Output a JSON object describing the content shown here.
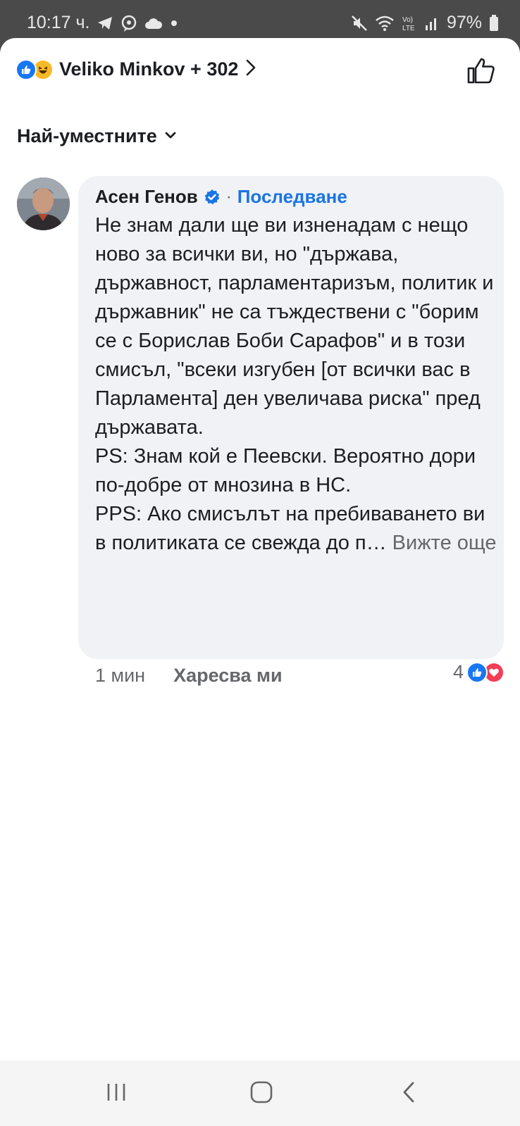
{
  "status_bar": {
    "time": "10:17 ч.",
    "battery": "97%",
    "icons": [
      "telegram-icon",
      "viber-icon",
      "cloud-icon",
      "dot-icon",
      "mute-icon",
      "wifi-icon",
      "volte-icon",
      "signal-icon",
      "battery-icon"
    ]
  },
  "header": {
    "reactions_text": "Veliko Minkov + 302",
    "reaction_icons": [
      "like-icon",
      "haha-icon"
    ]
  },
  "sort": {
    "label": "Най-уместните"
  },
  "comment": {
    "author": "Асен Генов",
    "separator": "·",
    "follow": "Последване",
    "text": "Не знам дали ще ви изненадам с нещо ново за всички ви, но \"държава, държавност, парламентаризъм, политик и държавник\" не са тъждествени с \"борим се с Борислав Боби Сарафов\" и в този смисъл, \"всеки изгубен [от всички вас в Парламента] ден увеличава риска\" пред държавата.\nPS: Знам кой е Пеевски. Вероятно дори по-добре от мнозина в НС.\nPPS: Ако смисълът на пребиваването ви в политиката се свежда до п… ",
    "see_more": "Вижте още",
    "time": "1 мин",
    "like_action": "Харесва ми",
    "reaction_count": "4"
  },
  "colors": {
    "accent": "#1b74e4",
    "like_blue": "#1877f2",
    "love_red": "#f33e58",
    "bubble_bg": "#f0f2f5",
    "muted": "#65676b"
  }
}
